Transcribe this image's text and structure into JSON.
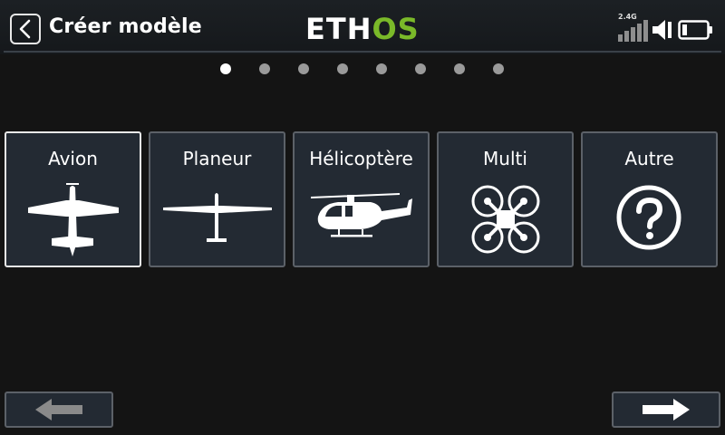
{
  "header": {
    "title": "Créer modèle",
    "logo_left": "ETH",
    "logo_right": "OS",
    "band_label": "2.4G",
    "icons": [
      "chevron-left-icon",
      "signal-icon",
      "speaker-icon",
      "battery-icon"
    ]
  },
  "pagination": {
    "total": 8,
    "active": 0
  },
  "model_types": [
    {
      "label": "Avion",
      "icon": "airplane-icon",
      "selected": true
    },
    {
      "label": "Planeur",
      "icon": "glider-icon",
      "selected": false
    },
    {
      "label": "Hélicoptère",
      "icon": "helicopter-icon",
      "selected": false
    },
    {
      "label": "Multi",
      "icon": "multirotor-icon",
      "selected": false
    },
    {
      "label": "Autre",
      "icon": "question-icon",
      "selected": false
    }
  ],
  "footer": {
    "prev_icon": "arrow-left-icon",
    "next_icon": "arrow-right-icon"
  },
  "colors": {
    "background": "#141414",
    "tile": "#232a33",
    "tile_border": "#5c6168",
    "selected_border": "#e8e8e8",
    "logo_accent": "#7ab929",
    "disabled_arrow": "#8a8a8a"
  }
}
